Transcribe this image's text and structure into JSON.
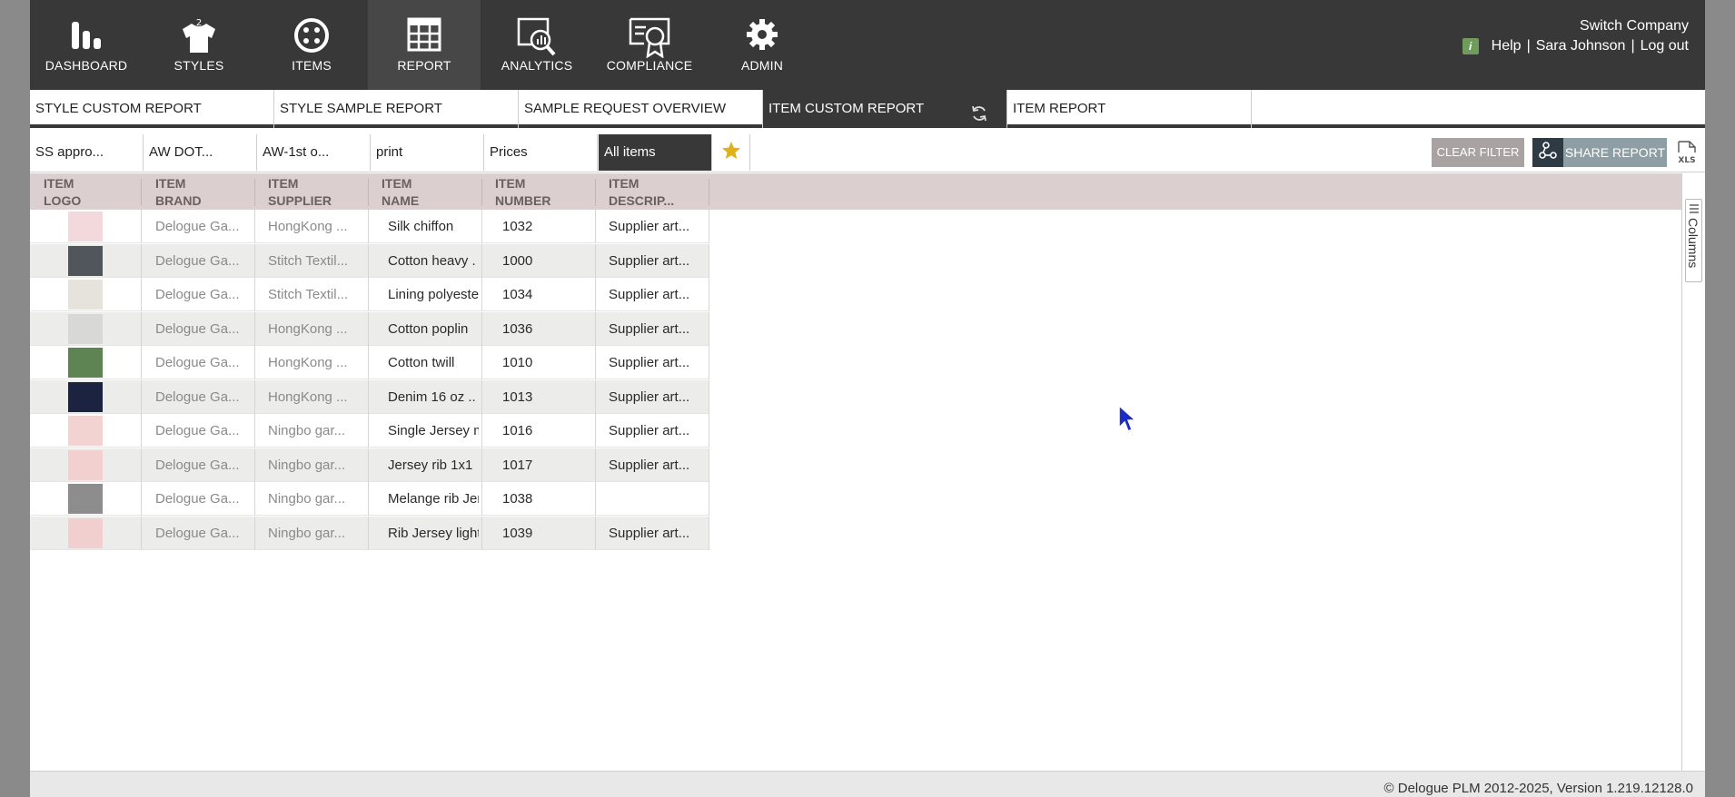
{
  "nav": {
    "items": [
      {
        "label": "DASHBOARD",
        "icon": "bar-chart-icon"
      },
      {
        "label": "STYLES",
        "icon": "shirt-icon"
      },
      {
        "label": "ITEMS",
        "icon": "button-icon"
      },
      {
        "label": "REPORT",
        "icon": "table-grid-icon",
        "active": true
      },
      {
        "label": "ANALYTICS",
        "icon": "analytics-magnifier-icon"
      },
      {
        "label": "COMPLIANCE",
        "icon": "certificate-icon"
      },
      {
        "label": "ADMIN",
        "icon": "gear-icon"
      }
    ],
    "company": "Switch Company",
    "info_badge": "i",
    "help": "Help",
    "user": "Sara Johnson",
    "logout": "Log out",
    "separator": "|"
  },
  "tabs": [
    {
      "label": "STYLE CUSTOM REPORT"
    },
    {
      "label": "STYLE SAMPLE REPORT"
    },
    {
      "label": "SAMPLE REQUEST OVERVIEW"
    },
    {
      "label": "ITEM CUSTOM REPORT",
      "active": true
    },
    {
      "label": "ITEM REPORT"
    }
  ],
  "filters": [
    {
      "label": "SS appro..."
    },
    {
      "label": "AW DOT..."
    },
    {
      "label": "AW-1st o..."
    },
    {
      "label": "print"
    },
    {
      "label": "Prices"
    },
    {
      "label": "All items",
      "active": true
    }
  ],
  "toolbar": {
    "clear_filter": "CLEAR FILTER",
    "share_report": "SHARE REPORT",
    "xls": "XLS",
    "star_color": "#e0b21a"
  },
  "table": {
    "headers": [
      {
        "line1": "ITEM",
        "line2": "LOGO"
      },
      {
        "line1": "ITEM",
        "line2": "BRAND"
      },
      {
        "line1": "ITEM",
        "line2": "SUPPLIER"
      },
      {
        "line1": "ITEM",
        "line2": "NAME"
      },
      {
        "line1": "ITEM",
        "line2": "NUMBER"
      },
      {
        "line1": "ITEM",
        "line2": "DESCRIP..."
      }
    ],
    "rows": [
      {
        "swatch": "#f4d9dc",
        "brand": "Delogue Ga...",
        "supplier": "HongKong ...",
        "name": "Silk chiffon",
        "number": "1032",
        "description": "Supplier art..."
      },
      {
        "swatch": "#50565c",
        "brand": "Delogue Ga...",
        "supplier": "Stitch Textil...",
        "name": "Cotton heavy  .",
        "number": "1000",
        "description": "Supplier art..."
      },
      {
        "swatch": "#e6e3dc",
        "brand": "Delogue Ga...",
        "supplier": "Stitch Textil...",
        "name": "Lining polyeste",
        "number": "1034",
        "description": "Supplier art..."
      },
      {
        "swatch": "#d8d8d6",
        "brand": "Delogue Ga...",
        "supplier": "HongKong ...",
        "name": "Cotton poplin",
        "number": "1036",
        "description": "Supplier art..."
      },
      {
        "swatch": "#5e8453",
        "brand": "Delogue Ga...",
        "supplier": "HongKong ...",
        "name": "Cotton twill",
        "number": "1010",
        "description": "Supplier art..."
      },
      {
        "swatch": "#1c2340",
        "brand": "Delogue Ga...",
        "supplier": "HongKong ...",
        "name": "Denim 16 oz  ..",
        "number": "1013",
        "description": "Supplier art..."
      },
      {
        "swatch": "#f2d3d2",
        "brand": "Delogue Ga...",
        "supplier": "Ningbo gar...",
        "name": "Single Jersey m",
        "number": "1016",
        "description": "Supplier art..."
      },
      {
        "swatch": "#f2d0cf",
        "brand": "Delogue Ga...",
        "supplier": "Ningbo gar...",
        "name": "Jersey rib 1x1",
        "number": "1017",
        "description": "Supplier art..."
      },
      {
        "swatch": "#8d8d8d",
        "brand": "Delogue Ga...",
        "supplier": "Ningbo gar...",
        "name": "Melange rib Jer",
        "number": "1038",
        "description": ""
      },
      {
        "swatch": "#f0cfce",
        "brand": "Delogue Ga...",
        "supplier": "Ningbo gar...",
        "name": "Rib Jersey light",
        "number": "1039",
        "description": "Supplier art..."
      }
    ]
  },
  "columns_panel": {
    "label": "Columns"
  },
  "footer": {
    "copyright": "© Delogue PLM 2012-2025, Version 1.219.12128.0"
  }
}
